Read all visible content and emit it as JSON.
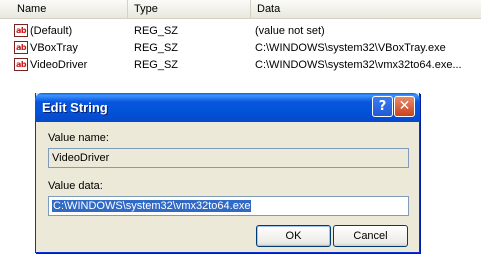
{
  "list": {
    "columns": [
      "Name",
      "Type",
      "Data"
    ],
    "rows": [
      {
        "icon": "ab",
        "name": "(Default)",
        "type": "REG_SZ",
        "data": "(value not set)"
      },
      {
        "icon": "ab",
        "name": "VBoxTray",
        "type": "REG_SZ",
        "data": "C:\\WINDOWS\\system32\\VBoxTray.exe"
      },
      {
        "icon": "ab",
        "name": "VideoDriver",
        "type": "REG_SZ",
        "data": "C:\\WINDOWS\\system32\\vmx32to64.exe..."
      }
    ]
  },
  "dialog": {
    "title": "Edit String",
    "help_glyph": "?",
    "close_glyph": "✕",
    "value_name_label": "Value name:",
    "value_name": "VideoDriver",
    "value_data_label": "Value data:",
    "value_data": "C:\\WINDOWS\\system32\\vmx32to64.exe",
    "ok_label": "OK",
    "cancel_label": "Cancel"
  },
  "colors": {
    "titlebar": "#0553d9",
    "selection": "#316ac5",
    "dialog_face": "#ece9d8"
  }
}
